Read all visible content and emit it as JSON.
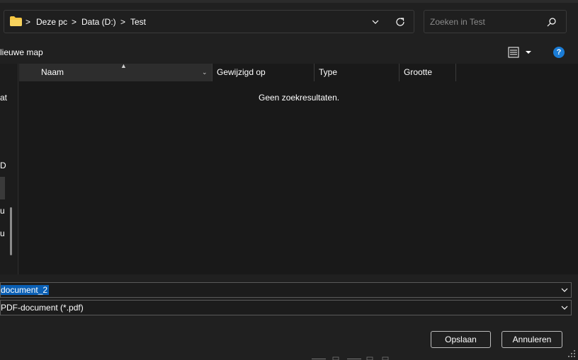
{
  "address": {
    "crumbs": [
      "Deze pc",
      "Data (D:)",
      "Test"
    ],
    "separator": ">",
    "icon": "folder-icon"
  },
  "search": {
    "placeholder": "Zoeken in Test",
    "icon": "search-icon"
  },
  "toolbar": {
    "new_folder_label": "lieuwe map",
    "view_icon": "list-view-icon",
    "help_label": "?"
  },
  "nav": {
    "items": [
      "at",
      "D",
      "u",
      "u"
    ]
  },
  "columns": {
    "name": "Naam",
    "modified": "Gewijzigd op",
    "type": "Type",
    "size": "Grootte"
  },
  "file_list": {
    "empty_message": "Geen zoekresultaten."
  },
  "save": {
    "filename": "document_2",
    "filetype": "PDF-document (*.pdf)",
    "save_label": "Opslaan",
    "cancel_label": "Annuleren"
  },
  "colors": {
    "accent": "#0a5fb4",
    "help_blue": "#1a7cd6",
    "folder_yellow": "#f4c542"
  }
}
